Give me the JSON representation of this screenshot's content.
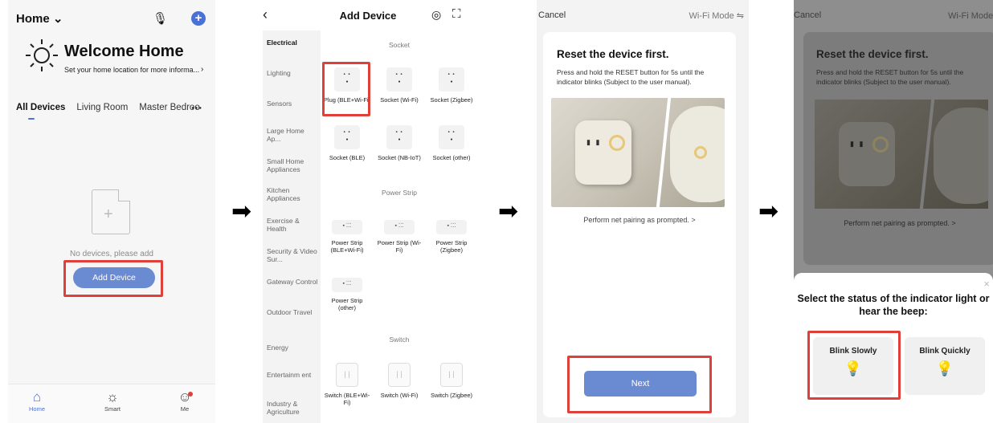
{
  "screen1": {
    "home_title": "Home ⌄",
    "welcome": "Welcome Home",
    "location_hint": "Set your home location for more informa...",
    "tabs": [
      "All Devices",
      "Living Room",
      "Master Bedroo"
    ],
    "more": "···",
    "empty_text": "No devices, please add",
    "add_device_button": "Add Device",
    "nav": [
      {
        "label": "Home",
        "icon": "home-icon"
      },
      {
        "label": "Smart",
        "icon": "sun-icon"
      },
      {
        "label": "Me",
        "icon": "user-icon"
      }
    ],
    "accent_color": "#4a72d6"
  },
  "screen2": {
    "title": "Add Device",
    "categories": [
      "Electrical",
      "Lighting",
      "Sensors",
      "Large Home Ap...",
      "Small Home Appliances",
      "Kitchen Appliances",
      "Exercise & Health",
      "Security & Video Sur...",
      "Gateway Control",
      "Outdoor Travel",
      "Energy",
      "Entertainm ent",
      "Industry & Agriculture"
    ],
    "sections": {
      "socket": "Socket",
      "power_strip": "Power Strip",
      "switch": "Switch"
    },
    "devices": {
      "plug_ble_wifi": "Plug (BLE+Wi-Fi)",
      "socket_wifi": "Socket (Wi-Fi)",
      "socket_zigbee": "Socket (Zigbee)",
      "socket_ble": "Socket (BLE)",
      "socket_nbiot": "Socket (NB-IoT)",
      "socket_other": "Socket (other)",
      "strip_ble_wifi": "Power Strip (BLE+Wi-Fi)",
      "strip_wifi": "Power Strip (Wi-Fi)",
      "strip_zigbee": "Power Strip (Zigbee)",
      "strip_other": "Power Strip (other)",
      "switch_ble_wifi": "Switch (BLE+Wi-Fi)",
      "switch_wifi": "Switch (Wi-Fi)",
      "switch_zigbee": "Switch (Zigbee)"
    }
  },
  "screen3": {
    "cancel": "Cancel",
    "mode": "Wi-Fi Mode ⇋",
    "reset_title": "Reset the device first.",
    "reset_desc": "Press and hold the RESET button for 5s until the indicator blinks (Subject to the user manual).",
    "pairing_link": "Perform net pairing as prompted. >",
    "next_button": "Next"
  },
  "screen4": {
    "cancel": "Cancel",
    "mode": "Wi-Fi Mode ⇋",
    "reset_title": "Reset the device first.",
    "reset_desc": "Press and hold the RESET button for 5s until the indicator blinks (Subject to the user manual).",
    "pairing_link": "Perform net pairing as prompted. >",
    "prompt": "Select the status of the indicator light or hear the beep:",
    "option_slow": "Blink Slowly",
    "option_quick": "Blink Quickly",
    "close": "×"
  },
  "arrow": "➡",
  "highlight_color": "#e0403a"
}
